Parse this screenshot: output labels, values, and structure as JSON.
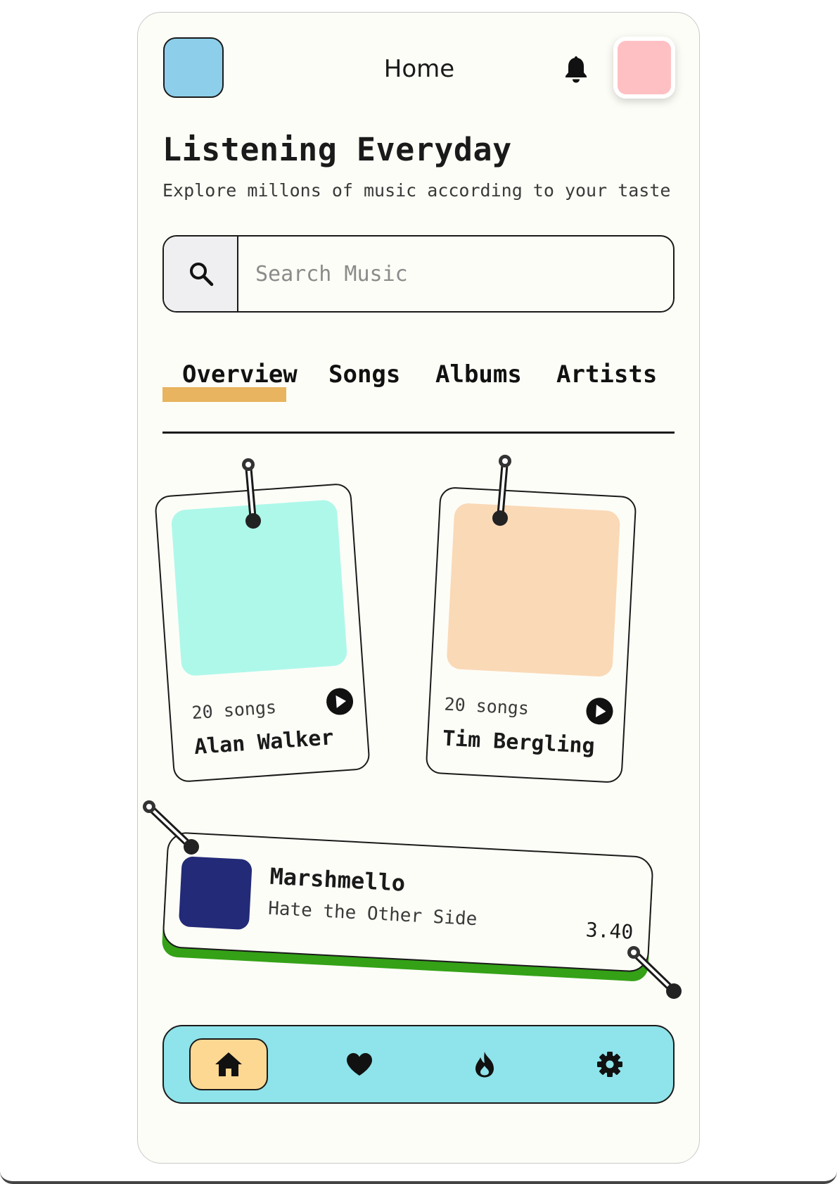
{
  "header": {
    "title": "Home"
  },
  "hero": {
    "title": "Listening Everyday",
    "subtitle": "Explore millons of music according to your taste"
  },
  "search": {
    "placeholder": "Search Music",
    "value": ""
  },
  "tabs": [
    {
      "label": "Overview",
      "active": true
    },
    {
      "label": "Songs",
      "active": false
    },
    {
      "label": "Albums",
      "active": false
    },
    {
      "label": "Artists",
      "active": false
    }
  ],
  "artist_cards": [
    {
      "name": "Alan Walker",
      "count": "20 songs",
      "art_color": "#aef8ea"
    },
    {
      "name": "Tim Bergling",
      "count": "20 songs",
      "art_color": "#fad9b7"
    }
  ],
  "now_playing": {
    "artist": "Marshmello",
    "title": "Hate the Other Side",
    "duration": "3.40",
    "art_color": "#232a77",
    "accent": "#34a117"
  },
  "bottom_nav": [
    {
      "icon": "home-icon",
      "active": true
    },
    {
      "icon": "heart-icon",
      "active": false
    },
    {
      "icon": "fire-icon",
      "active": false
    },
    {
      "icon": "gear-icon",
      "active": false
    }
  ],
  "colors": {
    "background": "#fdfdf7",
    "logo": "#8dcfea",
    "avatar": "#ffc0c3",
    "tab_highlight": "#e8b45f",
    "nav_bar": "#8fe3ea",
    "nav_active": "#fdd892"
  }
}
